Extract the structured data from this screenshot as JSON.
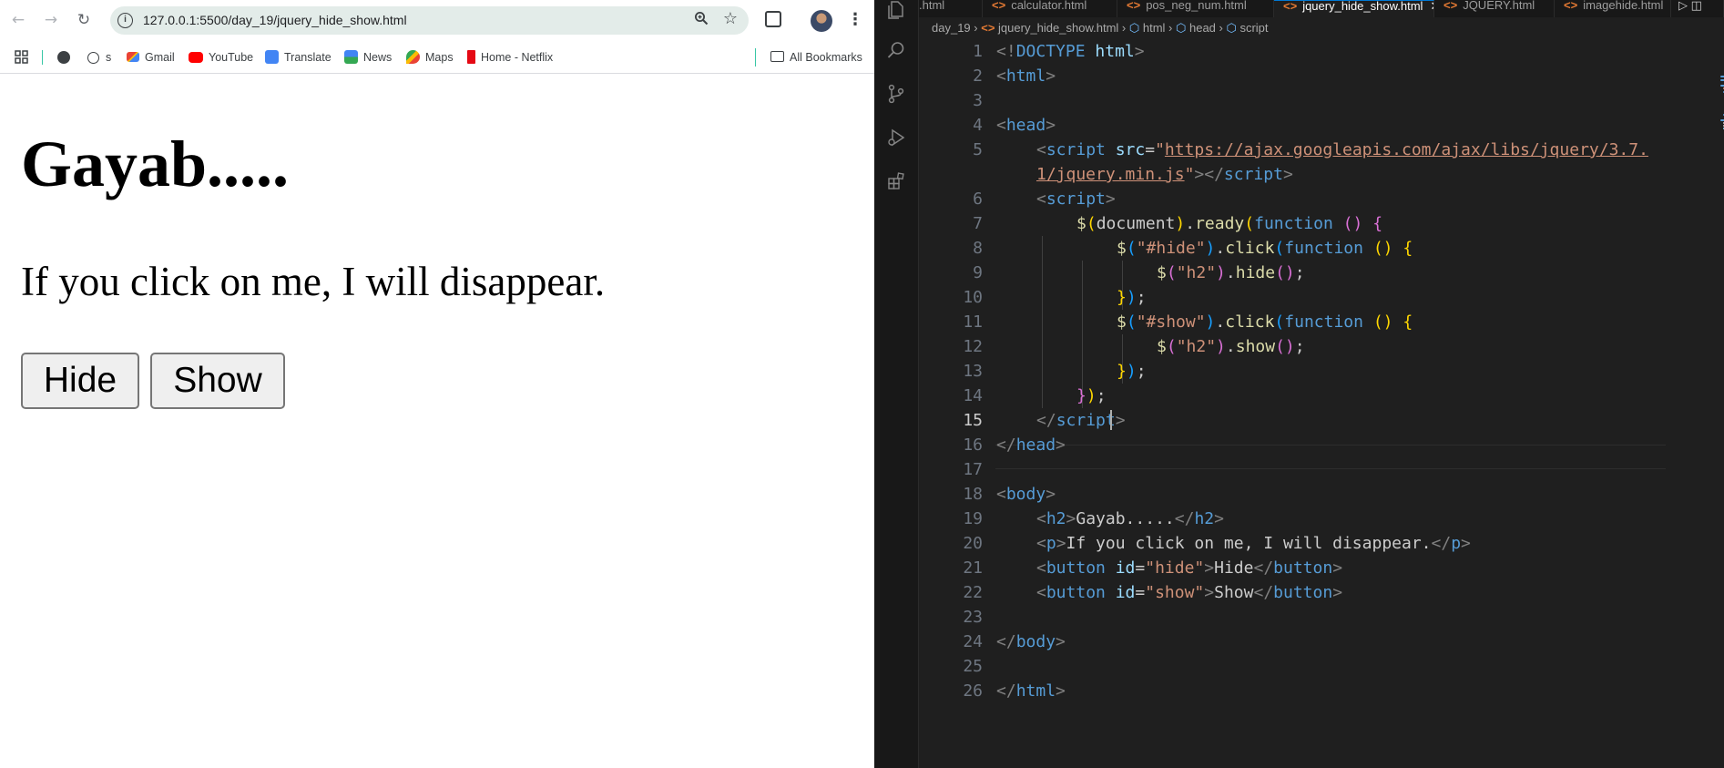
{
  "browser": {
    "url": "127.0.0.1:5500/day_19/jquery_hide_show.html",
    "bookmarks": [
      {
        "label": "",
        "icon": "globe-icon"
      },
      {
        "label": "s",
        "icon": "history-icon"
      },
      {
        "label": "Gmail",
        "icon": "gmail-icon"
      },
      {
        "label": "YouTube",
        "icon": "youtube-icon"
      },
      {
        "label": "Translate",
        "icon": "translate-icon"
      },
      {
        "label": "News",
        "icon": "news-icon"
      },
      {
        "label": "Maps",
        "icon": "maps-icon"
      },
      {
        "label": "Home - Netflix",
        "icon": "netflix-icon"
      }
    ],
    "all_bookmarks": "All Bookmarks",
    "page": {
      "heading": "Gayab.....",
      "paragraph": "If you click on me, I will disappear.",
      "hide_button": "Hide",
      "show_button": "Show"
    }
  },
  "editor": {
    "tabs": [
      {
        "label": ".html"
      },
      {
        "label": "calculator.html"
      },
      {
        "label": "pos_neg_num.html"
      },
      {
        "label": "jquery_hide_show.html",
        "active": true
      },
      {
        "label": "JQUERY.html"
      },
      {
        "label": "imagehide.html"
      }
    ],
    "breadcrumb": {
      "folder": "day_19",
      "file": "jquery_hide_show.html",
      "html": "html",
      "head": "head",
      "script": "script"
    },
    "line_numbers": [
      "1",
      "2",
      "3",
      "4",
      "5",
      "",
      "6",
      "7",
      "8",
      "9",
      "10",
      "11",
      "12",
      "13",
      "14",
      "15",
      "16",
      "17",
      "18",
      "19",
      "20",
      "21",
      "22",
      "23",
      "24",
      "25",
      "26"
    ],
    "code": {
      "l1": {
        "open": "<!",
        "doctype": "DOCTYPE",
        "space": " ",
        "html": "html",
        "close": ">"
      },
      "l2": {
        "open": "<",
        "tag": "html",
        "close": ">"
      },
      "l4": {
        "open": "<",
        "tag": "head",
        "close": ">"
      },
      "l5": {
        "open": "<",
        "tag": "script",
        "space": " ",
        "attr": "src",
        "eq": "=",
        "q1": "\"",
        "url": "https://ajax.googleapis.com/ajax/libs/jquery/3.7.",
        "end_open": "></",
        "end_tag": "script",
        "end_close": ">"
      },
      "l5b": {
        "url": "1/jquery.min.js",
        "q2": "\"",
        "end_open": "></",
        "end_tag": "script",
        "end_close": ">"
      },
      "l6": {
        "open": "<",
        "tag": "script",
        "close": ">"
      },
      "l7": {
        "fn": "$",
        "p1": "(",
        "arg": "document",
        "p2": ")",
        "dot": ".",
        "method": "ready",
        "p3": "(",
        "kw": "function",
        "sp": " ",
        "p4": "()",
        "sp2": " ",
        "brace": "{"
      },
      "l8": {
        "fn": "$",
        "p1": "(",
        "str": "\"#hide\"",
        "p2": ")",
        "dot": ".",
        "method": "click",
        "p3": "(",
        "kw": "function",
        "sp": " ",
        "p4": "()",
        "sp2": " ",
        "brace": "{"
      },
      "l9": {
        "fn": "$",
        "p1": "(",
        "str": "\"h2\"",
        "p2": ")",
        "dot": ".",
        "method": "hide",
        "p3": "()",
        "semi": ";"
      },
      "l10": {
        "brace": "}",
        "paren": ")",
        "semi": ";"
      },
      "l11": {
        "fn": "$",
        "p1": "(",
        "str": "\"#show\"",
        "p2": ")",
        "dot": ".",
        "method": "click",
        "p3": "(",
        "kw": "function",
        "sp": " ",
        "p4": "()",
        "sp2": " ",
        "brace": "{"
      },
      "l12": {
        "fn": "$",
        "p1": "(",
        "str": "\"h2\"",
        "p2": ")",
        "dot": ".",
        "method": "show",
        "p3": "()",
        "semi": ";"
      },
      "l13": {
        "brace": "}",
        "paren": ")",
        "semi": ";"
      },
      "l14": {
        "brace": "}",
        "paren": ")",
        "semi": ";"
      },
      "l15": {
        "open": "</",
        "tag": "script",
        "close": ">"
      },
      "l16": {
        "open": "</",
        "tag": "head",
        "close": ">"
      },
      "l18": {
        "open": "<",
        "tag": "body",
        "close": ">"
      },
      "l19": {
        "open": "<",
        "tag": "h2",
        "close": ">",
        "text": "Gayab.....",
        "e_open": "</",
        "e_tag": "h2",
        "e_close": ">"
      },
      "l20": {
        "open": "<",
        "tag": "p",
        "close": ">",
        "text": "If you click on me, I will disappear.",
        "e_open": "</",
        "e_tag": "p",
        "e_close": ">"
      },
      "l21": {
        "open": "<",
        "tag": "button",
        "sp": " ",
        "attr": "id",
        "eq": "=",
        "str": "\"hide\"",
        "close": ">",
        "text": "Hide",
        "e_open": "</",
        "e_tag": "button",
        "e_close": ">"
      },
      "l22": {
        "open": "<",
        "tag": "button",
        "sp": " ",
        "attr": "id",
        "eq": "=",
        "str": "\"show\"",
        "close": ">",
        "text": "Show",
        "e_open": "</",
        "e_tag": "button",
        "e_close": ">"
      },
      "l24": {
        "open": "</",
        "tag": "body",
        "close": ">"
      },
      "l26": {
        "open": "</",
        "tag": "html",
        "close": ">"
      }
    },
    "colors": {
      "background": "#1f1f1f",
      "tag": "#569cd6",
      "attribute": "#9cdcfe",
      "string": "#ce9178",
      "function": "#dcdcaa",
      "bracket_gold": "#ffd700",
      "bracket_orchid": "#da70d6",
      "bracket_blue": "#179fff"
    }
  }
}
